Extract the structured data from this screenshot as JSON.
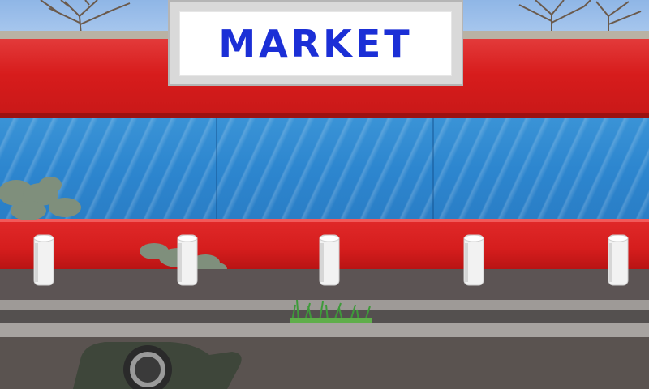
{
  "store_sign": {
    "text": "MARKET",
    "text_color": "#1b2fd6"
  },
  "colors": {
    "fascia_red": "#d71c1c",
    "window_blue": "#2d86cf",
    "sidewalk": "#5c5454",
    "curb": "#9e9a97",
    "road": "#5a5350",
    "bollard": "#f2f2f2"
  },
  "scene": {
    "bollards": [
      "bollard",
      "bollard",
      "bollard",
      "bollard",
      "bollard"
    ],
    "background_trees": [
      "bare-tree",
      "bare-tree"
    ],
    "shrubs": [
      "shrub",
      "shrub"
    ],
    "car": "car-shadow"
  }
}
